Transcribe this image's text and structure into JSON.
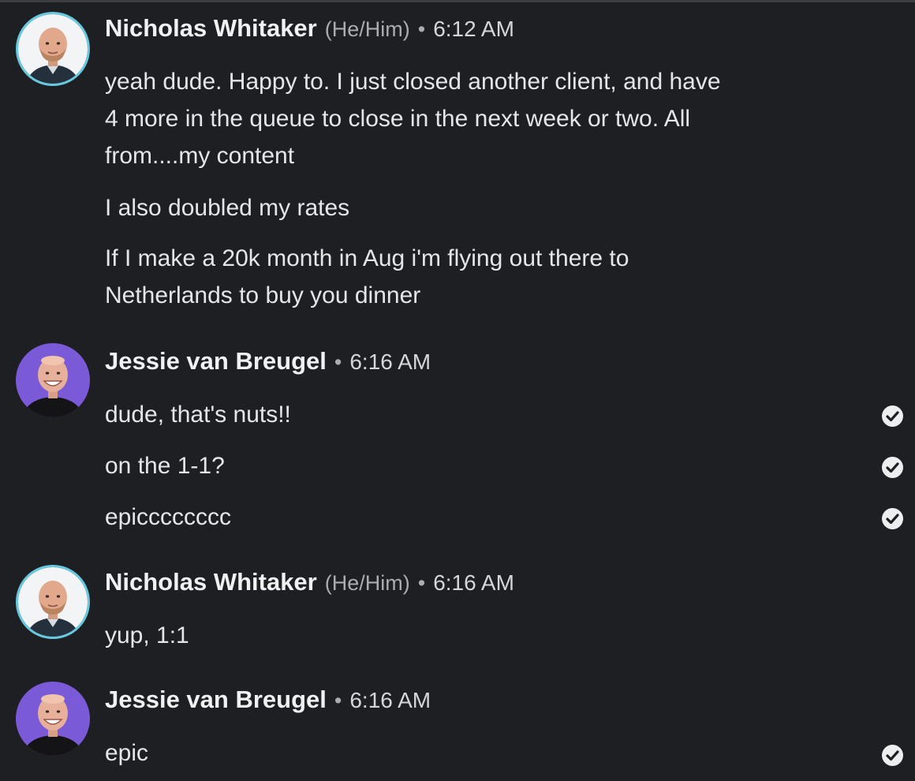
{
  "conversation": {
    "groups": [
      {
        "sender": "Nicholas Whitaker",
        "pronoun": "(He/Him)",
        "separator": "•",
        "time": "6:12 AM",
        "messages": [
          {
            "lines": [
              "yeah dude. Happy to. I just closed another client, and have",
              "4 more in the queue to close in the next week or two. All",
              "from....my content"
            ]
          },
          {
            "lines": [
              "I also doubled my rates"
            ]
          },
          {
            "lines": [
              "If I make a 20k month in Aug i'm flying out there to",
              "Netherlands to buy you dinner"
            ]
          }
        ]
      },
      {
        "sender": "Jessie van Breugel",
        "separator": "•",
        "time": "6:16 AM",
        "messages": [
          {
            "lines": [
              "dude, that's nuts!!"
            ],
            "status_icon": "check-circle-icon"
          },
          {
            "lines": [
              "on the 1-1?"
            ],
            "status_icon": "check-circle-icon"
          },
          {
            "lines": [
              "epicccccccc"
            ],
            "status_icon": "check-circle-icon"
          }
        ]
      },
      {
        "sender": "Nicholas Whitaker",
        "pronoun": "(He/Him)",
        "separator": "•",
        "time": "6:16 AM",
        "messages": [
          {
            "lines": [
              "yup, 1:1"
            ]
          }
        ]
      },
      {
        "sender": "Jessie van Breugel",
        "separator": "•",
        "time": "6:16 AM",
        "messages": [
          {
            "lines": [
              "epic"
            ],
            "status_icon": "check-circle-icon"
          }
        ]
      }
    ]
  },
  "colors": {
    "background": "#1d1f22",
    "nicholas_avatar_ring": "#67c9e0",
    "jessie_avatar_bg": "#7a5ad6",
    "read_check": "#eceef0"
  }
}
